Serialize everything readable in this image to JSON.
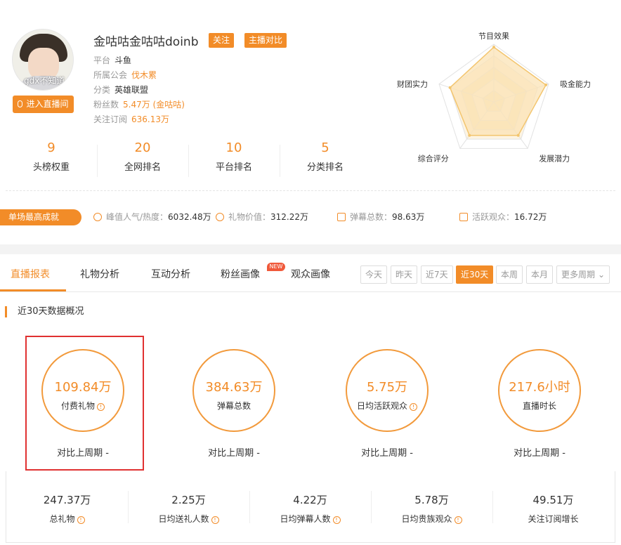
{
  "profile": {
    "name": "金咕咕金咕咕doinb",
    "follow_label": "关注",
    "compare_label": "主播对比",
    "enter_label": "进入直播间",
    "avatar_watermark": "gdx不知道",
    "platform_label": "平台",
    "platform_value": "斗鱼",
    "guild_label": "所属公会",
    "guild_value": "伐木累",
    "category_label": "分类",
    "category_value": "英雄联盟",
    "fans_label": "粉丝数",
    "fans_value": "5.47万 (金咕咕)",
    "subs_label": "关注订阅",
    "subs_value": "636.13万"
  },
  "ranks": [
    {
      "value": "9",
      "label": "头榜权重"
    },
    {
      "value": "20",
      "label": "全网排名"
    },
    {
      "value": "10",
      "label": "平台排名"
    },
    {
      "value": "5",
      "label": "分类排名"
    }
  ],
  "radar": {
    "labels": [
      "节目效果",
      "吸金能力",
      "发展潜力",
      "综合评分",
      "财团实力"
    ],
    "values": [
      0.95,
      0.95,
      0.72,
      0.72,
      0.8
    ],
    "colors": {
      "fill": "#fbe3b6",
      "stroke": "#f3c56e",
      "grid": "#e2e2e2"
    }
  },
  "achievements": {
    "tag": "单场最高成就",
    "items": [
      {
        "label": "峰值人气/热度：",
        "value": "6032.48万",
        "icon": "person-icon"
      },
      {
        "label": "礼物价值：",
        "value": "312.22万",
        "icon": "coin-icon"
      },
      {
        "label": "弹幕总数：",
        "value": "98.63万",
        "icon": "danmaku-icon"
      },
      {
        "label": "活跃观众：",
        "value": "16.72万",
        "icon": "audience-icon"
      }
    ]
  },
  "tabs": [
    "直播报表",
    "礼物分析",
    "互动分析",
    "粉丝画像",
    "观众画像"
  ],
  "new_badge": "NEW",
  "periods": [
    "今天",
    "昨天",
    "近7天",
    "近30天",
    "本周",
    "本月",
    "更多周期"
  ],
  "active_period": "近30天",
  "section_title": "近30天数据概况",
  "stats": [
    {
      "value": "109.84万",
      "label": "付费礼物",
      "compare": "对比上周期 -"
    },
    {
      "value": "384.63万",
      "label": "弹幕总数",
      "compare": "对比上周期 -"
    },
    {
      "value": "5.75万",
      "label": "日均活跃观众",
      "compare": "对比上周期 -"
    },
    {
      "value": "217.6小时",
      "label": "直播时长",
      "compare": "对比上周期 -"
    }
  ],
  "bottom_stats": [
    {
      "value": "247.37万",
      "label": "总礼物"
    },
    {
      "value": "2.25万",
      "label": "日均送礼人数"
    },
    {
      "value": "4.22万",
      "label": "日均弹幕人数"
    },
    {
      "value": "5.78万",
      "label": "日均贵族观众"
    },
    {
      "value": "49.51万",
      "label": "关注订阅增长"
    }
  ],
  "accent_color": "#f28c28"
}
